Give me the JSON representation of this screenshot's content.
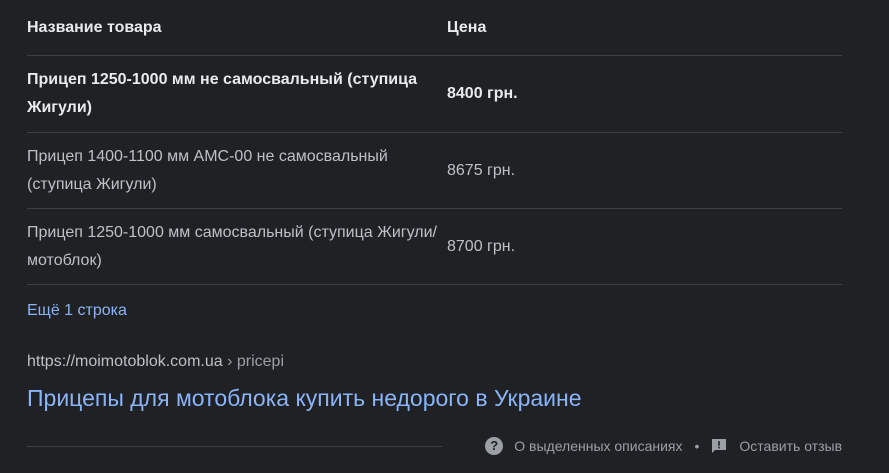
{
  "table": {
    "header": {
      "name": "Название товара",
      "price": "Цена"
    },
    "rows": [
      {
        "name": "Прицеп 1250-1000 мм не самосвальный (ступица Жигули)",
        "price": "8400 грн."
      },
      {
        "name": "Прицеп 1400-1100 мм АМС-00 не самосвальный (ступица Жигули)",
        "price": "8675 грн."
      },
      {
        "name": "Прицеп 1250-1000 мм самосвальный (ступица Жигули/мотоблок)",
        "price": "8700 грн."
      }
    ]
  },
  "more_link": "Ещё 1 строка",
  "result": {
    "url": "https://moimotoblok.com.ua",
    "separator": "›",
    "path": "pricepi",
    "title": "Прицепы для мотоблока купить недорого в Украине"
  },
  "footer": {
    "about": "О выделенных описаниях",
    "bullet": "•",
    "feedback": "Оставить отзыв"
  },
  "colors": {
    "background": "#202124",
    "link": "#8ab4f8",
    "text": "#bdc1c6"
  }
}
